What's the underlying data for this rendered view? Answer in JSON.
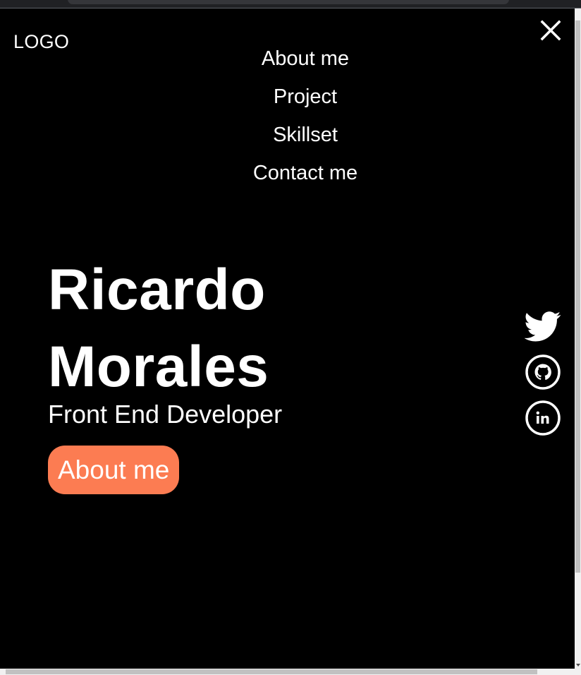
{
  "header": {
    "logo_text": "LOGO",
    "close_icon": "close-icon"
  },
  "nav": {
    "items": [
      {
        "label": "About me"
      },
      {
        "label": "Project"
      },
      {
        "label": "Skillset"
      },
      {
        "label": "Contact me"
      }
    ]
  },
  "hero": {
    "name_line1": "Ricardo",
    "name_line2": "Morales",
    "role": "Front End Developer",
    "cta_label": "About me"
  },
  "social": {
    "icons": [
      "twitter-icon",
      "github-icon",
      "linkedin-icon"
    ]
  },
  "colors": {
    "background": "#000000",
    "text": "#ffffff",
    "accent": "#fc7c52"
  }
}
